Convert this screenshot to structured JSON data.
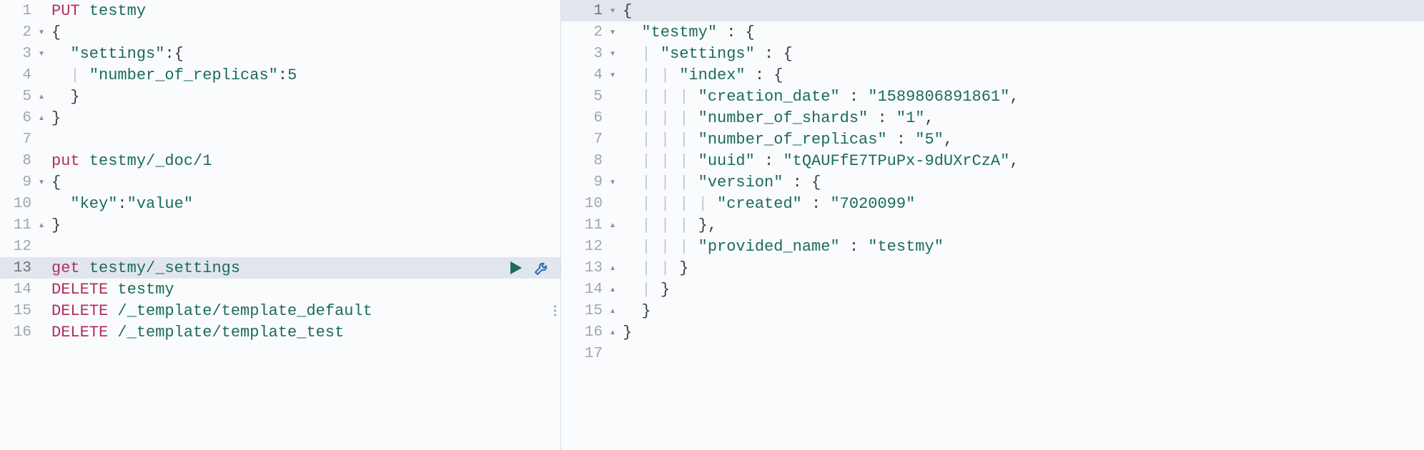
{
  "left": {
    "lines": [
      {
        "num": "1",
        "fold": "",
        "tokens": [
          {
            "t": "PUT",
            "c": "method-put"
          },
          {
            "t": " "
          },
          {
            "t": "testmy",
            "c": "path"
          }
        ]
      },
      {
        "num": "2",
        "fold": "▾",
        "tokens": [
          {
            "t": "{",
            "c": "punc"
          }
        ]
      },
      {
        "num": "3",
        "fold": "▾",
        "tokens": [
          {
            "t": "  "
          },
          {
            "t": "\"settings\"",
            "c": "key"
          },
          {
            "t": ":",
            "c": "colon"
          },
          {
            "t": "{",
            "c": "punc"
          }
        ]
      },
      {
        "num": "4",
        "fold": "",
        "tokens": [
          {
            "t": "  "
          },
          {
            "t": "|",
            "c": "indent-guide"
          },
          {
            "t": " "
          },
          {
            "t": "\"number_of_replicas\"",
            "c": "key"
          },
          {
            "t": ":",
            "c": "colon"
          },
          {
            "t": "5",
            "c": "str"
          }
        ]
      },
      {
        "num": "5",
        "fold": "▴",
        "tokens": [
          {
            "t": "  }",
            "c": "punc"
          }
        ]
      },
      {
        "num": "6",
        "fold": "▴",
        "tokens": [
          {
            "t": "}",
            "c": "punc"
          }
        ]
      },
      {
        "num": "7",
        "fold": "",
        "tokens": [
          {
            "t": " "
          }
        ]
      },
      {
        "num": "8",
        "fold": "",
        "tokens": [
          {
            "t": "put",
            "c": "method-put"
          },
          {
            "t": " "
          },
          {
            "t": "testmy/_doc/1",
            "c": "path"
          }
        ]
      },
      {
        "num": "9",
        "fold": "▾",
        "tokens": [
          {
            "t": "{",
            "c": "punc"
          }
        ]
      },
      {
        "num": "10",
        "fold": "",
        "tokens": [
          {
            "t": "  "
          },
          {
            "t": "\"key\"",
            "c": "key"
          },
          {
            "t": ":",
            "c": "colon"
          },
          {
            "t": "\"value\"",
            "c": "str"
          }
        ]
      },
      {
        "num": "11",
        "fold": "▴",
        "tokens": [
          {
            "t": "}",
            "c": "punc"
          }
        ]
      },
      {
        "num": "12",
        "fold": "",
        "tokens": [
          {
            "t": " "
          }
        ]
      },
      {
        "num": "13",
        "fold": "",
        "hl": true,
        "actions": true,
        "tokens": [
          {
            "t": "get",
            "c": "method-get"
          },
          {
            "t": " "
          },
          {
            "t": "testmy/_settings",
            "c": "path"
          }
        ]
      },
      {
        "num": "14",
        "fold": "",
        "tokens": [
          {
            "t": "DELETE",
            "c": "method-delete"
          },
          {
            "t": " "
          },
          {
            "t": "testmy",
            "c": "path"
          }
        ]
      },
      {
        "num": "15",
        "fold": "",
        "tokens": [
          {
            "t": "DELETE",
            "c": "method-delete"
          },
          {
            "t": " "
          },
          {
            "t": "/_template/template_default",
            "c": "path"
          }
        ]
      },
      {
        "num": "16",
        "fold": "",
        "tokens": [
          {
            "t": "DELETE",
            "c": "method-delete"
          },
          {
            "t": " "
          },
          {
            "t": "/_template/template_test",
            "c": "path"
          }
        ]
      }
    ]
  },
  "right": {
    "lines": [
      {
        "num": "1",
        "fold": "▾",
        "hl": true,
        "tokens": [
          {
            "t": "{",
            "c": "punc"
          }
        ]
      },
      {
        "num": "2",
        "fold": "▾",
        "tokens": [
          {
            "t": "  "
          },
          {
            "t": "\"testmy\"",
            "c": "key"
          },
          {
            "t": " : ",
            "c": "colon"
          },
          {
            "t": "{",
            "c": "punc"
          }
        ]
      },
      {
        "num": "3",
        "fold": "▾",
        "tokens": [
          {
            "t": "  "
          },
          {
            "t": "|",
            "c": "indent-guide"
          },
          {
            "t": " "
          },
          {
            "t": "\"settings\"",
            "c": "key"
          },
          {
            "t": " : ",
            "c": "colon"
          },
          {
            "t": "{",
            "c": "punc"
          }
        ]
      },
      {
        "num": "4",
        "fold": "▾",
        "tokens": [
          {
            "t": "  "
          },
          {
            "t": "|",
            "c": "indent-guide"
          },
          {
            "t": " "
          },
          {
            "t": "|",
            "c": "indent-guide"
          },
          {
            "t": " "
          },
          {
            "t": "\"index\"",
            "c": "key"
          },
          {
            "t": " : ",
            "c": "colon"
          },
          {
            "t": "{",
            "c": "punc"
          }
        ]
      },
      {
        "num": "5",
        "fold": "",
        "tokens": [
          {
            "t": "  "
          },
          {
            "t": "|",
            "c": "indent-guide"
          },
          {
            "t": " "
          },
          {
            "t": "|",
            "c": "indent-guide"
          },
          {
            "t": " "
          },
          {
            "t": "|",
            "c": "indent-guide"
          },
          {
            "t": " "
          },
          {
            "t": "\"creation_date\"",
            "c": "key"
          },
          {
            "t": " : ",
            "c": "colon"
          },
          {
            "t": "\"1589806891861\"",
            "c": "str"
          },
          {
            "t": ",",
            "c": "punc"
          }
        ]
      },
      {
        "num": "6",
        "fold": "",
        "tokens": [
          {
            "t": "  "
          },
          {
            "t": "|",
            "c": "indent-guide"
          },
          {
            "t": " "
          },
          {
            "t": "|",
            "c": "indent-guide"
          },
          {
            "t": " "
          },
          {
            "t": "|",
            "c": "indent-guide"
          },
          {
            "t": " "
          },
          {
            "t": "\"number_of_shards\"",
            "c": "key"
          },
          {
            "t": " : ",
            "c": "colon"
          },
          {
            "t": "\"1\"",
            "c": "str"
          },
          {
            "t": ",",
            "c": "punc"
          }
        ]
      },
      {
        "num": "7",
        "fold": "",
        "tokens": [
          {
            "t": "  "
          },
          {
            "t": "|",
            "c": "indent-guide"
          },
          {
            "t": " "
          },
          {
            "t": "|",
            "c": "indent-guide"
          },
          {
            "t": " "
          },
          {
            "t": "|",
            "c": "indent-guide"
          },
          {
            "t": " "
          },
          {
            "t": "\"number_of_replicas\"",
            "c": "key"
          },
          {
            "t": " : ",
            "c": "colon"
          },
          {
            "t": "\"5\"",
            "c": "str"
          },
          {
            "t": ",",
            "c": "punc"
          }
        ]
      },
      {
        "num": "8",
        "fold": "",
        "tokens": [
          {
            "t": "  "
          },
          {
            "t": "|",
            "c": "indent-guide"
          },
          {
            "t": " "
          },
          {
            "t": "|",
            "c": "indent-guide"
          },
          {
            "t": " "
          },
          {
            "t": "|",
            "c": "indent-guide"
          },
          {
            "t": " "
          },
          {
            "t": "\"uuid\"",
            "c": "key"
          },
          {
            "t": " : ",
            "c": "colon"
          },
          {
            "t": "\"tQAUFfE7TPuPx-9dUXrCzA\"",
            "c": "str"
          },
          {
            "t": ",",
            "c": "punc"
          }
        ]
      },
      {
        "num": "9",
        "fold": "▾",
        "tokens": [
          {
            "t": "  "
          },
          {
            "t": "|",
            "c": "indent-guide"
          },
          {
            "t": " "
          },
          {
            "t": "|",
            "c": "indent-guide"
          },
          {
            "t": " "
          },
          {
            "t": "|",
            "c": "indent-guide"
          },
          {
            "t": " "
          },
          {
            "t": "\"version\"",
            "c": "key"
          },
          {
            "t": " : ",
            "c": "colon"
          },
          {
            "t": "{",
            "c": "punc"
          }
        ]
      },
      {
        "num": "10",
        "fold": "",
        "tokens": [
          {
            "t": "  "
          },
          {
            "t": "|",
            "c": "indent-guide"
          },
          {
            "t": " "
          },
          {
            "t": "|",
            "c": "indent-guide"
          },
          {
            "t": " "
          },
          {
            "t": "|",
            "c": "indent-guide"
          },
          {
            "t": " "
          },
          {
            "t": "|",
            "c": "indent-guide"
          },
          {
            "t": " "
          },
          {
            "t": "\"created\"",
            "c": "key"
          },
          {
            "t": " : ",
            "c": "colon"
          },
          {
            "t": "\"7020099\"",
            "c": "str"
          }
        ]
      },
      {
        "num": "11",
        "fold": "▴",
        "tokens": [
          {
            "t": "  "
          },
          {
            "t": "|",
            "c": "indent-guide"
          },
          {
            "t": " "
          },
          {
            "t": "|",
            "c": "indent-guide"
          },
          {
            "t": " "
          },
          {
            "t": "|",
            "c": "indent-guide"
          },
          {
            "t": " "
          },
          {
            "t": "}",
            "c": "punc"
          },
          {
            "t": ",",
            "c": "punc"
          }
        ]
      },
      {
        "num": "12",
        "fold": "",
        "tokens": [
          {
            "t": "  "
          },
          {
            "t": "|",
            "c": "indent-guide"
          },
          {
            "t": " "
          },
          {
            "t": "|",
            "c": "indent-guide"
          },
          {
            "t": " "
          },
          {
            "t": "|",
            "c": "indent-guide"
          },
          {
            "t": " "
          },
          {
            "t": "\"provided_name\"",
            "c": "key"
          },
          {
            "t": " : ",
            "c": "colon"
          },
          {
            "t": "\"testmy\"",
            "c": "str"
          }
        ]
      },
      {
        "num": "13",
        "fold": "▴",
        "tokens": [
          {
            "t": "  "
          },
          {
            "t": "|",
            "c": "indent-guide"
          },
          {
            "t": " "
          },
          {
            "t": "|",
            "c": "indent-guide"
          },
          {
            "t": " "
          },
          {
            "t": "}",
            "c": "punc"
          }
        ]
      },
      {
        "num": "14",
        "fold": "▴",
        "tokens": [
          {
            "t": "  "
          },
          {
            "t": "|",
            "c": "indent-guide"
          },
          {
            "t": " "
          },
          {
            "t": "}",
            "c": "punc"
          }
        ]
      },
      {
        "num": "15",
        "fold": "▴",
        "tokens": [
          {
            "t": "  }",
            "c": "punc"
          }
        ],
        "dragdots": true
      },
      {
        "num": "16",
        "fold": "▴",
        "tokens": [
          {
            "t": "}",
            "c": "punc"
          }
        ]
      },
      {
        "num": "17",
        "fold": "",
        "tokens": [
          {
            "t": " "
          }
        ]
      }
    ]
  }
}
